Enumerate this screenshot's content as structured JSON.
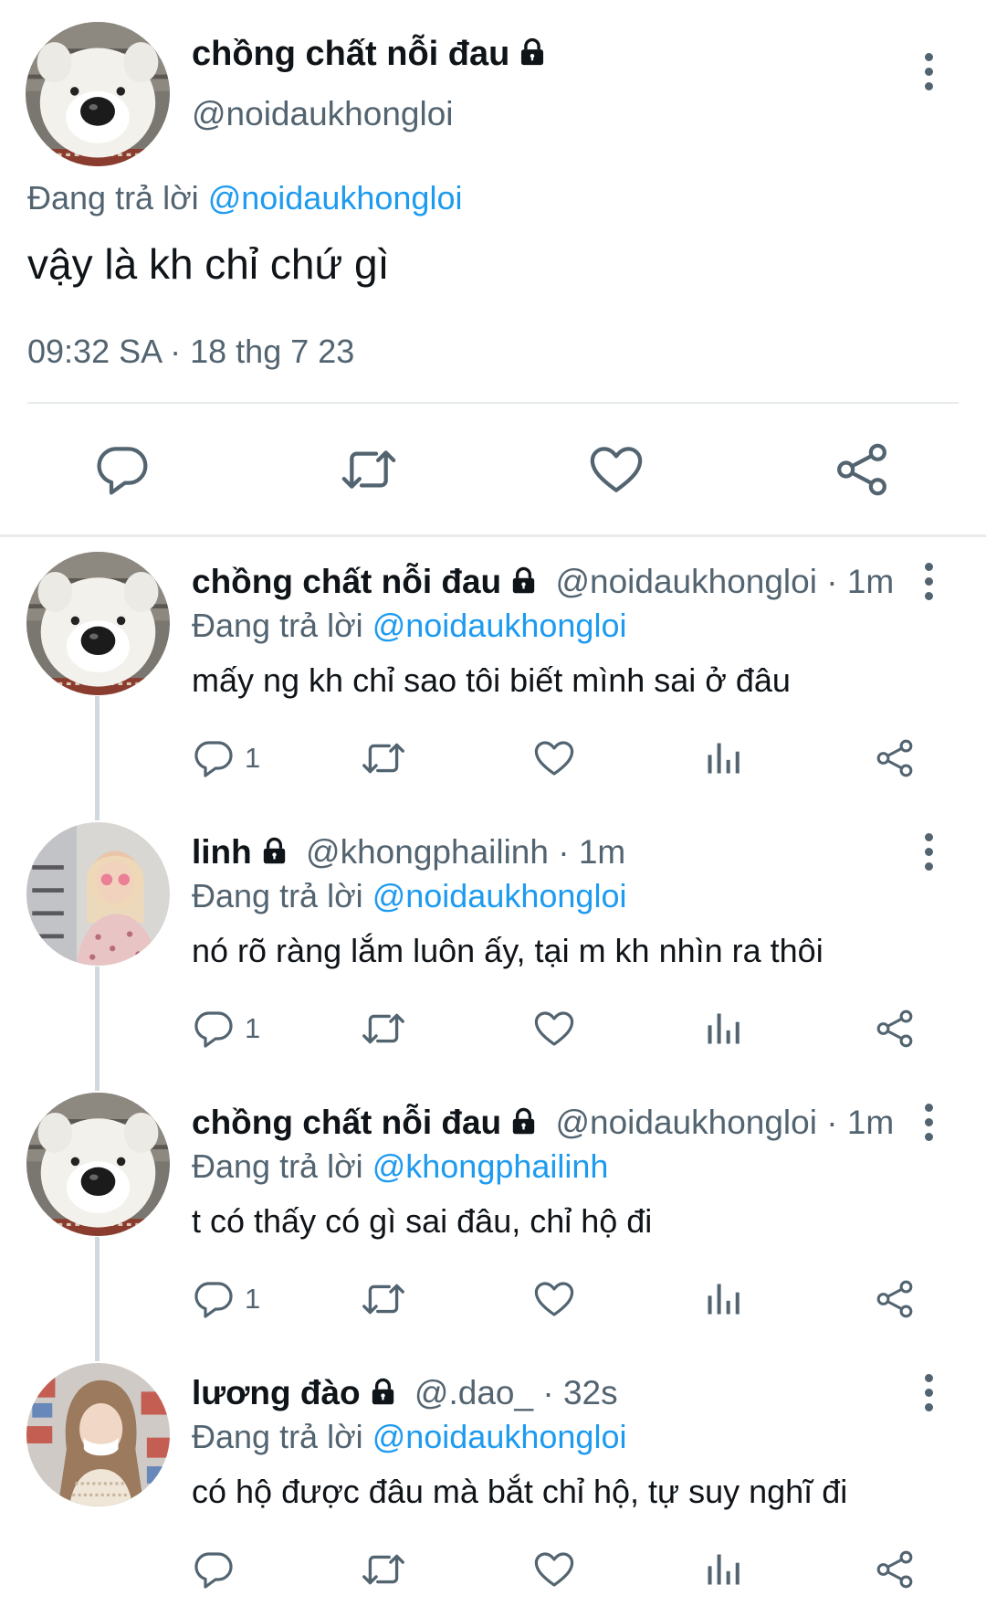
{
  "main_tweet": {
    "name": "chồng chất nỗi đau",
    "handle": "@noidaukhongloi",
    "replying_label": "Đang trả lời",
    "replying_to": "@noidaukhongloi",
    "text": "vậy là kh chỉ chứ gì",
    "timestamp": "09:32 SA · 18 thg 7 23",
    "actions": [
      "reply-icon",
      "retweet-icon",
      "like-icon",
      "share-icon"
    ]
  },
  "replies": [
    {
      "name": "chồng chất nỗi đau",
      "meta": "@noidaukhongloi · 1m",
      "replying_label": "Đang trả lời",
      "replying_to": "@noidaukhongloi",
      "text": "mấy ng kh chỉ sao tôi biết mình sai ở đâu",
      "reply_count": "1"
    },
    {
      "name": "linh",
      "meta": "@khongphailinh · 1m",
      "replying_label": "Đang trả lời",
      "replying_to": "@noidaukhongloi",
      "text": "nó rõ ràng lắm luôn ấy, tại m kh nhìn ra thôi",
      "reply_count": "1"
    },
    {
      "name": "chồng chất nỗi đau",
      "meta": "@noidaukhongloi · 1m",
      "replying_label": "Đang trả lời",
      "replying_to": "@khongphailinh",
      "text": "t có thấy có gì sai đâu, chỉ hộ đi",
      "reply_count": "1"
    },
    {
      "name": "lương đào",
      "meta": "@.dao_ · 32s",
      "replying_label": "Đang trả lời",
      "replying_to": "@noidaukhongloi",
      "text": "có hộ được đâu mà bắt chỉ hộ, tự suy nghĩ đi",
      "reply_count": ""
    }
  ],
  "colors": {
    "text": "#0f1419",
    "secondary": "#536471",
    "link": "#1d9bf0",
    "divider": "#e8ebed"
  }
}
